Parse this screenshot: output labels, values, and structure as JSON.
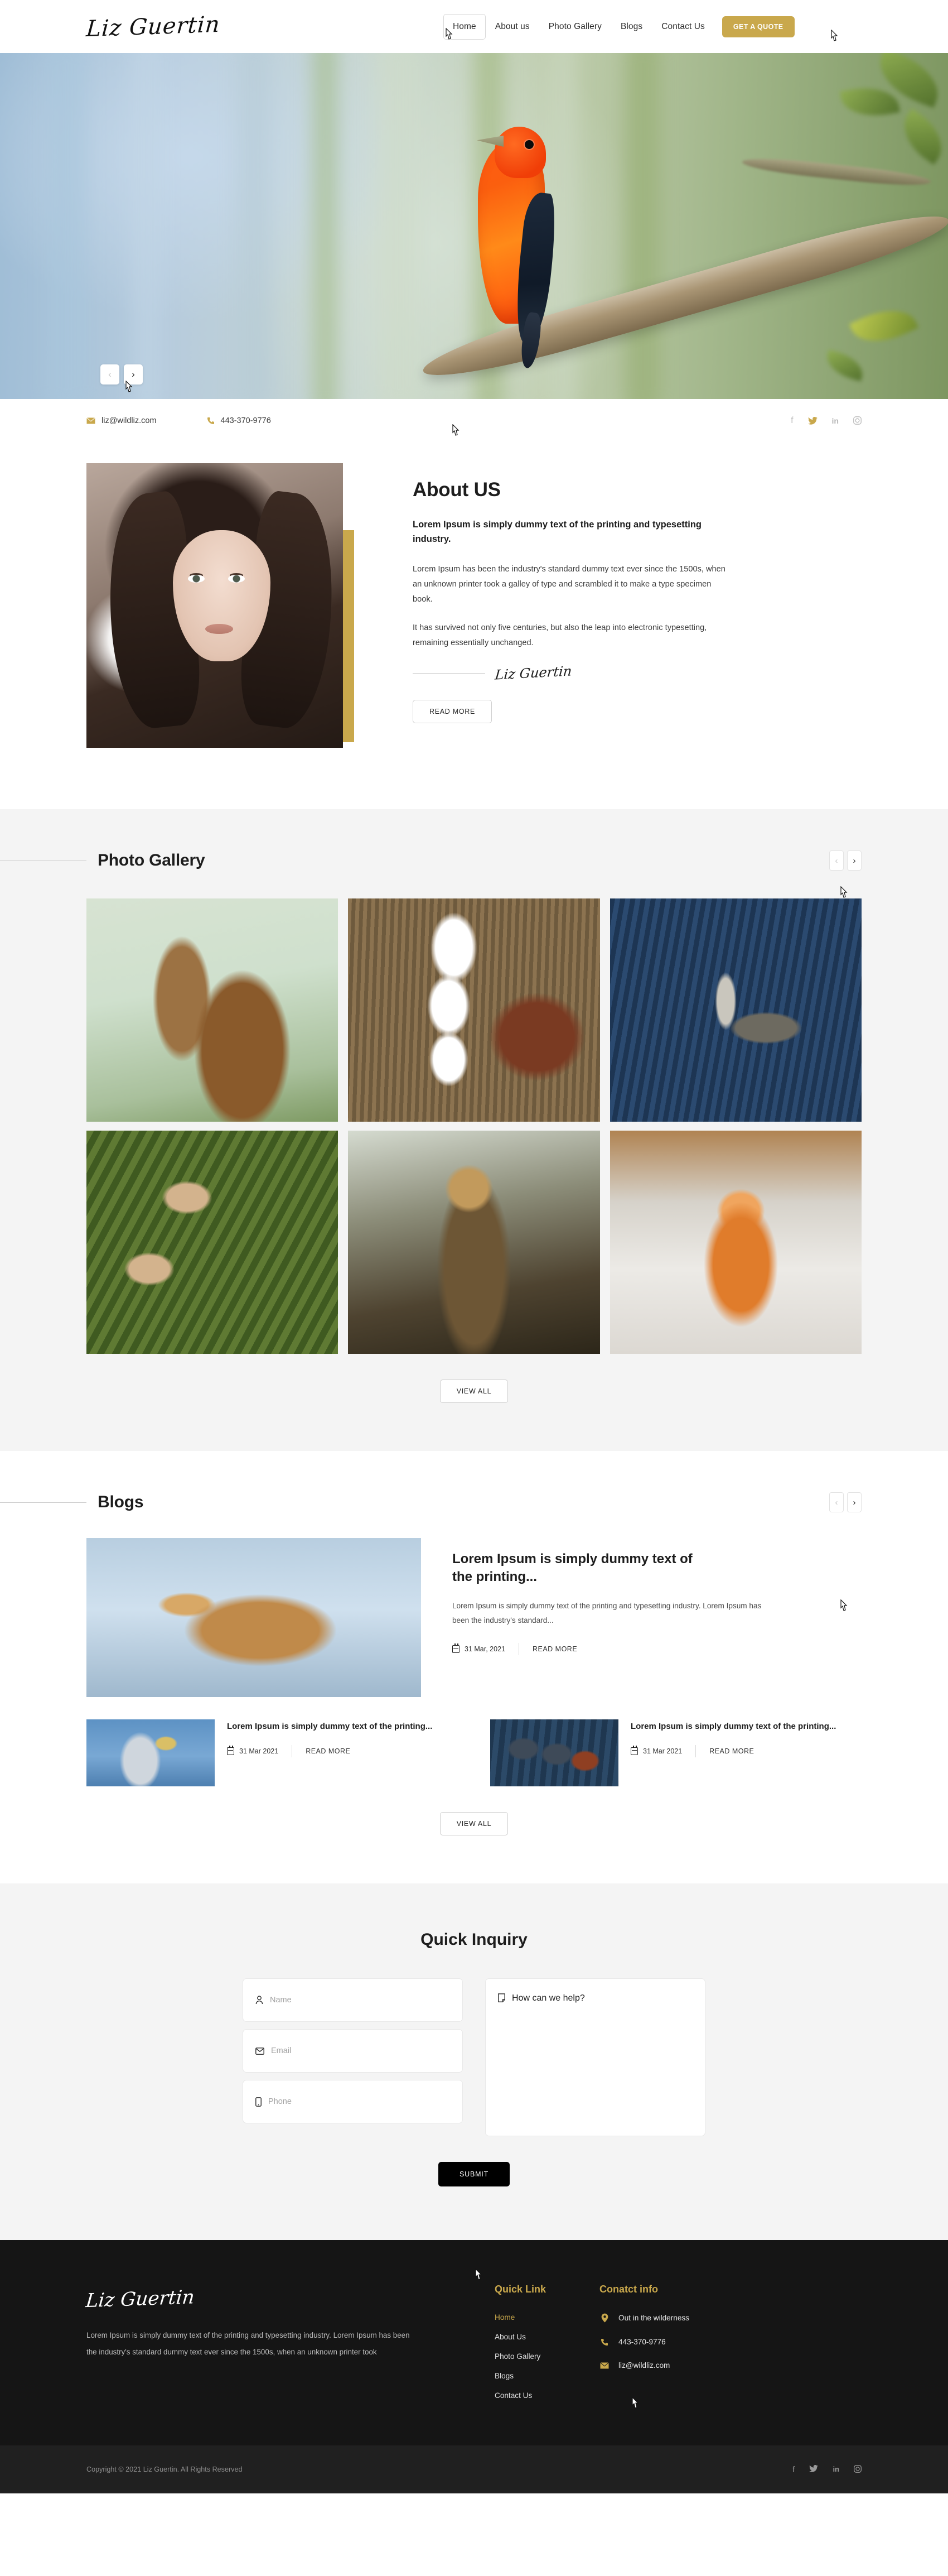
{
  "header": {
    "brand": "Liz Guertin",
    "nav": [
      {
        "label": "Home",
        "active": true
      },
      {
        "label": "About us",
        "active": false
      },
      {
        "label": "Photo Gallery",
        "active": false
      },
      {
        "label": "Blogs",
        "active": false
      },
      {
        "label": "Contact Us",
        "active": false
      }
    ],
    "quote_button": "GET A QUOTE"
  },
  "hero": {
    "prev_label": "‹",
    "next_label": "›",
    "image_alt": "scarlet-tanager-on-branch"
  },
  "contact_bar": {
    "email": "liz@wildliz.com",
    "phone": "443-370-9776",
    "social": [
      {
        "name": "facebook",
        "glyph": "f",
        "active": false
      },
      {
        "name": "twitter",
        "glyph": "ᵥ",
        "active": true
      },
      {
        "name": "linkedin",
        "glyph": "in",
        "active": false
      },
      {
        "name": "instagram",
        "glyph": "▢",
        "active": false
      }
    ]
  },
  "about": {
    "title": "About US",
    "lead": "Lorem Ipsum is simply dummy text of the printing and typesetting industry.",
    "paragraph1": "Lorem Ipsum has been the industry's standard dummy text ever since the 1500s, when an unknown printer took a galley of type and scrambled it to make a type specimen book.",
    "paragraph2": "It has survived not only five centuries, but also the leap into electronic typesetting, remaining essentially unchanged.",
    "signature": "Liz Guertin",
    "read_more": "READ MORE",
    "image_alt": "portrait-of-woman"
  },
  "gallery": {
    "title": "Photo Gallery",
    "prev_label": "‹",
    "next_label": "›",
    "view_all": "VIEW ALL",
    "items": [
      {
        "alt": "duck-flapping-wings",
        "css": "img-duck"
      },
      {
        "alt": "hooded-mergansers",
        "css": "img-mergansers"
      },
      {
        "alt": "red-throated-loon",
        "css": "img-loon"
      },
      {
        "alt": "cedar-waxwings-on-juniper",
        "css": "img-waxwing"
      },
      {
        "alt": "great-horned-owl",
        "css": "img-owl"
      },
      {
        "alt": "red-fox-in-snow",
        "css": "img-fox"
      }
    ]
  },
  "blogs": {
    "title": "Blogs",
    "prev_label": "‹",
    "next_label": "›",
    "view_all": "VIEW ALL",
    "featured": {
      "heading": "Lorem Ipsum is simply dummy text of the printing...",
      "excerpt": "Lorem Ipsum is simply dummy text of the printing and typesetting industry. Lorem Ipsum has been the industry's standard...",
      "date": "31 Mar, 2021",
      "read_more": "READ MORE",
      "image_alt": "leaping-hare-in-snow"
    },
    "cards": [
      {
        "heading": "Lorem Ipsum is simply dummy text of the printing...",
        "date": "31 Mar 2021",
        "read_more": "READ MORE",
        "image_alt": "gull-calling"
      },
      {
        "heading": "Lorem Ipsum is simply dummy text of the printing...",
        "date": "31 Mar 2021",
        "read_more": "READ MORE",
        "image_alt": "harlequin-ducks"
      }
    ]
  },
  "inquiry": {
    "title": "Quick Inquiry",
    "name_placeholder": "Name",
    "email_placeholder": "Email",
    "phone_placeholder": "Phone",
    "message_placeholder": "How can we help?",
    "submit": "SUBMIT"
  },
  "footer": {
    "brand": "Liz Guertin",
    "about": "Lorem Ipsum is simply dummy text of the printing and typesetting industry. Lorem Ipsum has been the industry's standard dummy text ever since the 1500s, when an unknown printer took",
    "quick_link_title": "Quick Link",
    "quick_links": [
      {
        "label": "Home",
        "active": true
      },
      {
        "label": "About Us",
        "active": false
      },
      {
        "label": "Photo Gallery",
        "active": false
      },
      {
        "label": "Blogs",
        "active": false
      },
      {
        "label": "Contact Us",
        "active": false
      }
    ],
    "contact_title": "Conatct info",
    "contact_items": [
      {
        "icon": "location-pin-icon",
        "glyph": "●",
        "text": "Out in the wilderness"
      },
      {
        "icon": "phone-icon",
        "glyph": "✆",
        "text": "443-370-9776"
      },
      {
        "icon": "envelope-icon",
        "glyph": "✉",
        "text": "liz@wildliz.com"
      }
    ],
    "copyright": "Copyright © 2021 Liz Guertin. All Rights Reserved",
    "social": [
      {
        "name": "facebook",
        "glyph": "f"
      },
      {
        "name": "twitter",
        "glyph": "ᵥ"
      },
      {
        "name": "linkedin",
        "glyph": "in"
      },
      {
        "name": "instagram",
        "glyph": "▢"
      }
    ]
  },
  "colors": {
    "gold": "#c9a84c",
    "dark": "#151515",
    "light_gray": "#f4f4f4"
  }
}
